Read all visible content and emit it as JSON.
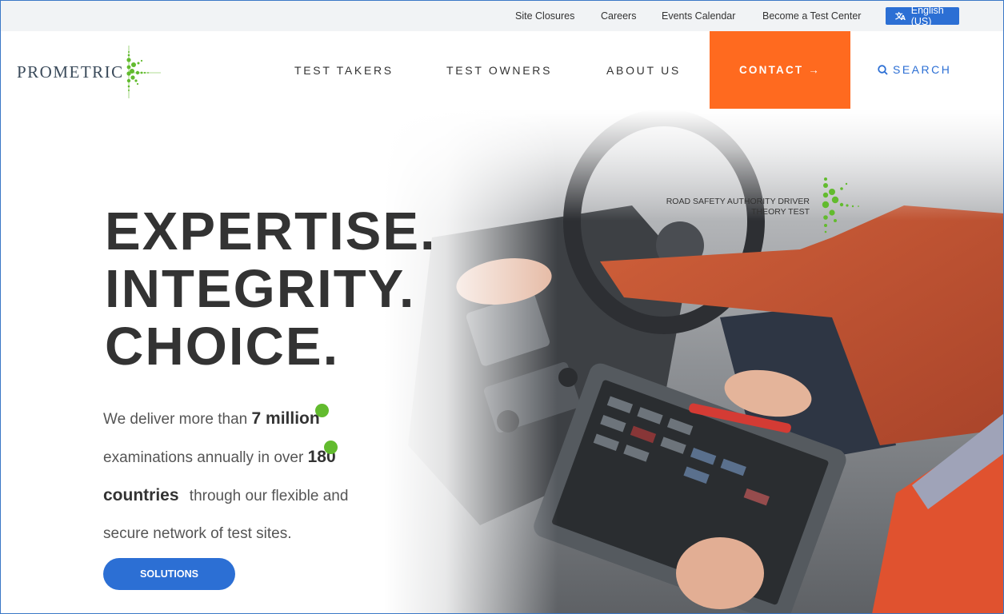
{
  "utility_nav": {
    "links": [
      "Site Closures",
      "Careers",
      "Events Calendar",
      "Become a Test Center"
    ],
    "language": "English (US)"
  },
  "header": {
    "logo_text": "PROMETRIC",
    "nav": [
      "TEST TAKERS",
      "TEST OWNERS",
      "ABOUT US"
    ],
    "contact": "CONTACT →",
    "search": "SEARCH"
  },
  "hero": {
    "headline": [
      "EXPERTISE.",
      "INTEGRITY.",
      "CHOICE."
    ],
    "copy_1": "We deliver more than ",
    "stat_1": "7 million",
    "copy_2": "examinations annually in over ",
    "stat_2": "180",
    "stat_3": "countries",
    "copy_3": " through our flexible and",
    "copy_4": "secure network of test sites.",
    "cta": "SOLUTIONS",
    "image_caption": [
      "ROAD SAFETY AUTHORITY DRIVER",
      "THEORY TEST"
    ]
  },
  "colors": {
    "accent_orange": "#ff6a1f",
    "brand_blue": "#2c6fd4",
    "brand_green": "#62bb2e",
    "text_dark": "#333333"
  }
}
